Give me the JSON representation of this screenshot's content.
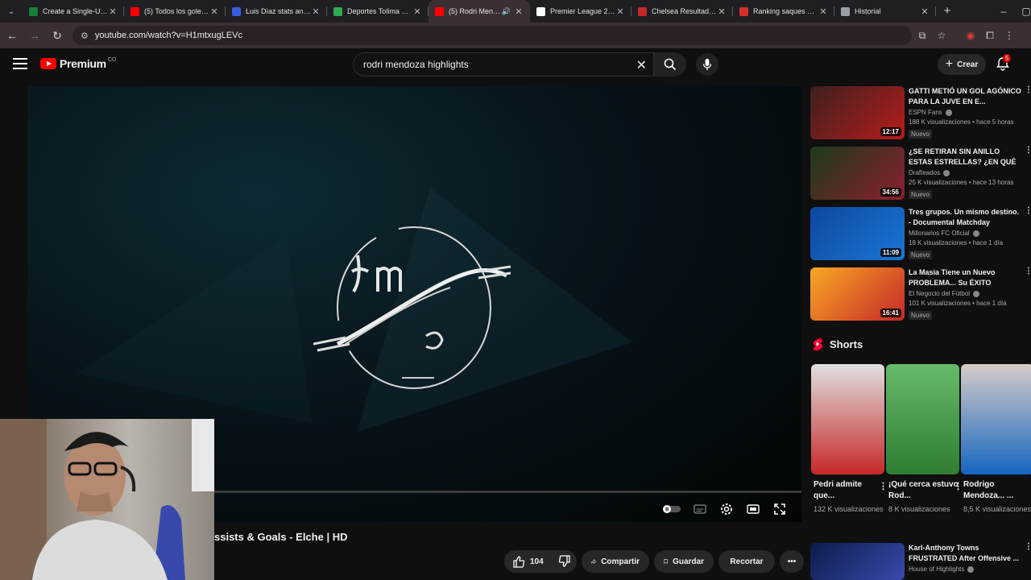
{
  "tabs": [
    {
      "title": "Create a Single-Use T",
      "color": "#188038"
    },
    {
      "title": "(5) Todos los goles de",
      "color": "#ff0000"
    },
    {
      "title": "Luis Díaz stats and ra",
      "color": "#3b5bdb"
    },
    {
      "title": "Deportes Tolima Vs A",
      "color": "#34a853"
    },
    {
      "title": "(5) Rodri Mendoz",
      "color": "#ff0000"
    },
    {
      "title": "Premier League 2025",
      "color": "#ffffff"
    },
    {
      "title": "Chelsea Resultados, c",
      "color": "#c62828"
    },
    {
      "title": "Ranking saques de es",
      "color": "#d32f2f"
    },
    {
      "title": "Historial",
      "color": "#9aa0a6"
    }
  ],
  "address": {
    "url": "youtube.com/watch?v=H1mtxugLEVc"
  },
  "masthead": {
    "logo_text": "Premium",
    "logo_suffix": "CO",
    "search_value": "rodri mendoza highlights",
    "create_label": "Crear",
    "notification_count": "5"
  },
  "video": {
    "title": "ssists & Goals - Elche | HD",
    "likes": "104",
    "share_label": "Compartir",
    "save_label": "Guardar",
    "clip_label": "Recortar"
  },
  "recommendations": [
    {
      "title": "GATTI METIÓ UN GOL AGÓNICO PARA LA JUVE EN E...",
      "channel": "ESPN Fans",
      "views": "188 K visualizaciones • hace 5 horas",
      "badge": "Nuevo",
      "duration": "12:17",
      "colors": [
        "#3d1f1f",
        "#b71c1c"
      ]
    },
    {
      "title": "¿SE RETIRAN SIN ANILLO ESTAS ESTRELLAS? ¿EN QUÉ ...",
      "channel": "Drafteados",
      "views": "25 K visualizaciones • hace 13 horas",
      "badge": "Nuevo",
      "duration": "34:56",
      "colors": [
        "#1b3a1b",
        "#8d1f2f"
      ]
    },
    {
      "title": "Tres grupos. Un mismo destino. - Documental Matchday",
      "channel": "Millonarios FC Oficial",
      "views": "18 K visualizaciones • hace 1 día",
      "badge": "Nuevo",
      "duration": "11:09",
      "colors": [
        "#0d47a1",
        "#1976d2"
      ]
    },
    {
      "title": "La Masia Tiene un Nuevo PROBLEMA... Su ÉXITO",
      "channel": "El Negocio del Fútbol",
      "views": "101 K visualizaciones • hace 1 día",
      "badge": "Nuevo",
      "duration": "16:41",
      "colors": [
        "#f9a825",
        "#c62828"
      ]
    }
  ],
  "shorts": {
    "heading": "Shorts",
    "items": [
      {
        "title": "Pedri admite que...",
        "views": "132 K visualizaciones",
        "colors": [
          "#c62828",
          "#e0e0e0"
        ]
      },
      {
        "title": "¡Qué cerca estuvo Rod...",
        "views": "8 K visualizaciones",
        "colors": [
          "#2e7d32",
          "#66bb6a"
        ]
      },
      {
        "title": "Rodrigo Mendoza... ...",
        "views": "8,5 K visualizaciones",
        "colors": [
          "#1565c0",
          "#d7ccc8"
        ]
      }
    ]
  },
  "next_rec": {
    "title": "Karl-Anthony Towns FRUSTRATED After Offensive ...",
    "channel": "House of Highlights"
  }
}
